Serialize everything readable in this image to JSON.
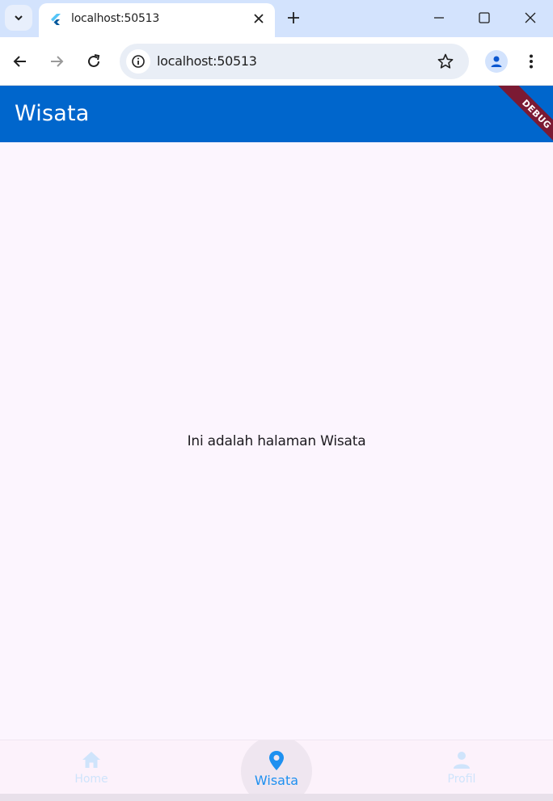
{
  "browser": {
    "tab_title": "localhost:50513",
    "url": "localhost:50513"
  },
  "app": {
    "title": "Wisata",
    "debug_banner": "DEBUG",
    "content_text": "Ini adalah halaman Wisata",
    "accent_color": "#0066cc",
    "nav": [
      {
        "label": "Home",
        "icon": "home-icon",
        "active": false
      },
      {
        "label": "Wisata",
        "icon": "location-pin-icon",
        "active": true
      },
      {
        "label": "Profil",
        "icon": "person-icon",
        "active": false
      }
    ]
  }
}
